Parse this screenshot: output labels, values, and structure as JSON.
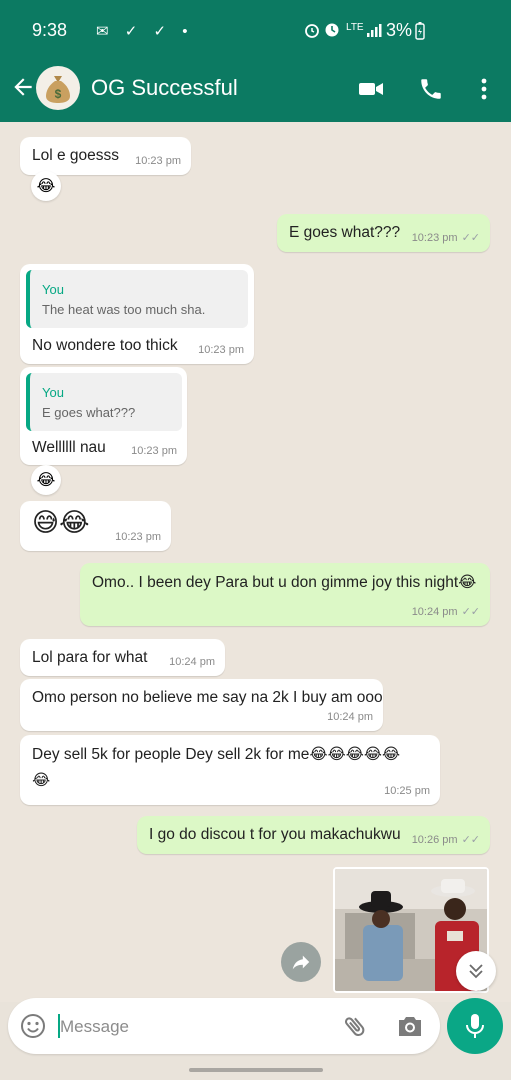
{
  "status_bar": {
    "time": "9:38",
    "left_icons": "✉ ✓ ✓ •",
    "network": "LTE",
    "battery": "3%"
  },
  "header": {
    "title": "OG Successful",
    "avatar_icon": "money-bag-icon"
  },
  "colors": {
    "header": "#0c7a62",
    "outgoing_bubble": "#dcf8c6",
    "accent": "#06a884"
  },
  "messages": [
    {
      "dir": "in",
      "text": "Lol e goesss",
      "time": "10:23 pm",
      "reaction": "😂"
    },
    {
      "dir": "out",
      "text": "E goes what???",
      "time": "10:23 pm"
    },
    {
      "dir": "in",
      "quote_author": "You",
      "quote_text": "The heat was too much sha.",
      "text": "No wondere too thick",
      "time": "10:23 pm"
    },
    {
      "dir": "in",
      "quote_author": "You",
      "quote_text": "E goes what???",
      "text": "Wellllll nau",
      "time": "10:23 pm",
      "reaction": "😂"
    },
    {
      "dir": "in",
      "text": "😅😂",
      "time": "10:23 pm"
    },
    {
      "dir": "out",
      "text": "Omo.. I been dey Para but u don gimme joy this night😂",
      "time": "10:24 pm"
    },
    {
      "dir": "in",
      "text": "Lol para for what",
      "time": "10:24 pm"
    },
    {
      "dir": "in",
      "text": "Omo person no believe me say na 2k I buy am ooo",
      "time": "10:24 pm"
    },
    {
      "dir": "in",
      "text_line1": "Dey sell 5k for people Dey sell 2k for me😂😂😂😂😂",
      "text_line2": "😂",
      "time": "10:25 pm"
    },
    {
      "dir": "out",
      "text": "I go do discou t for you makachukwu",
      "time": "10:26 pm"
    }
  ],
  "composer": {
    "placeholder": "Message"
  }
}
